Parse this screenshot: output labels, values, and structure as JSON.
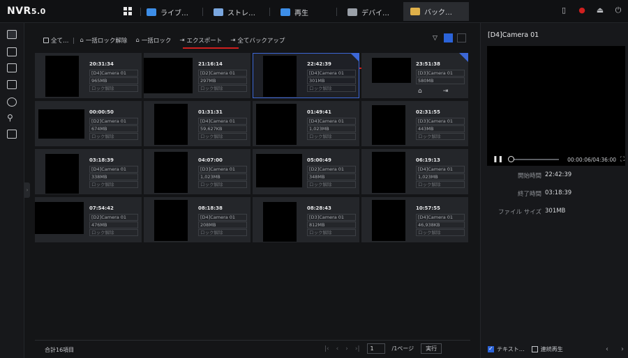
{
  "app": {
    "logo_main": "NVR",
    "logo_version": "5.0"
  },
  "tabs": [
    {
      "label": "ライブ…",
      "icon": "live-view-icon",
      "color": "#3d8ee8"
    },
    {
      "label": "ストレ…",
      "icon": "storage-icon",
      "color": "#7aa7e0"
    },
    {
      "label": "再生",
      "icon": "playback-icon",
      "color": "#3d8ee8"
    },
    {
      "label": "デバイ…",
      "icon": "device-icon",
      "color": "#9aa0a8"
    },
    {
      "label": "バック…",
      "icon": "backup-folder-icon",
      "color": "#e0b14a"
    }
  ],
  "top_right_icons": [
    "battery-icon",
    "alarm-bell-icon",
    "export-icon",
    "power-icon"
  ],
  "toolbar": {
    "select_all": "全て…",
    "unlock_all": "一括ロック解除",
    "lock_all": "一括ロック",
    "export": "エクスポート",
    "backup_all": "全てバックアップ"
  },
  "cards": [
    {
      "time": "20:31:34",
      "camera": "[D4]Camera 01",
      "size": "965MB",
      "lock": "ロック解除",
      "selected": false
    },
    {
      "time": "21:16:14",
      "camera": "[D2]Camera 01",
      "size": "297MB",
      "lock": "ロック解除",
      "selected": false
    },
    {
      "time": "22:42:39",
      "camera": "[D4]Camera 01",
      "size": "301MB",
      "lock": "ロック解除",
      "selected": true
    },
    {
      "time": "23:51:38",
      "camera": "[D3]Camera 01",
      "size": "580MB",
      "lock": "",
      "selected": false
    },
    {
      "time": "00:00:50",
      "camera": "[D2]Camera 01",
      "size": "674MB",
      "lock": "ロック解除",
      "selected": false
    },
    {
      "time": "01:31:31",
      "camera": "[D4]Camera 01",
      "size": "59,627KB",
      "lock": "ロック解除",
      "selected": false
    },
    {
      "time": "01:49:41",
      "camera": "[D4]Camera 01",
      "size": "1,023MB",
      "lock": "ロック解除",
      "selected": false
    },
    {
      "time": "02:31:55",
      "camera": "[D3]Camera 01",
      "size": "443MB",
      "lock": "ロック解除",
      "selected": false
    },
    {
      "time": "03:18:39",
      "camera": "[D4]Camera 01",
      "size": "338MB",
      "lock": "ロック解除",
      "selected": false
    },
    {
      "time": "04:07:00",
      "camera": "[D3]Camera 01",
      "size": "1,023MB",
      "lock": "ロック解除",
      "selected": false
    },
    {
      "time": "05:00:49",
      "camera": "[D2]Camera 01",
      "size": "348MB",
      "lock": "ロック解除",
      "selected": false
    },
    {
      "time": "06:19:13",
      "camera": "[D4]Camera 01",
      "size": "1,023MB",
      "lock": "ロック解除",
      "selected": false
    },
    {
      "time": "07:54:42",
      "camera": "[D2]Camera 01",
      "size": "476MB",
      "lock": "ロック解除",
      "selected": false
    },
    {
      "time": "08:18:38",
      "camera": "[D4]Camera 01",
      "size": "208MB",
      "lock": "ロック解除",
      "selected": false
    },
    {
      "time": "08:28:43",
      "camera": "[D3]Camera 01",
      "size": "812MB",
      "lock": "ロック解除",
      "selected": false
    },
    {
      "time": "10:57:55",
      "camera": "[D4]Camera 01",
      "size": "46,938KB",
      "lock": "ロック解除",
      "selected": false
    }
  ],
  "footer": {
    "total": "合計16項目",
    "page_value": "1",
    "page_of": "/1ページ",
    "go": "実行"
  },
  "preview": {
    "camera_title": "[D4]Camera 01",
    "time_readout": "00:00:06/04:36:00",
    "start_label": "開始時間",
    "start_value": "22:42:39",
    "end_label": "終了時間",
    "end_value": "03:18:39",
    "size_label": "ファイル サイズ",
    "size_value": "301MB",
    "text_label": "テキスト…",
    "continuous_label": "連続再生"
  },
  "colors": {
    "accent_blue": "#2b63d9",
    "selection_border": "#3c67d6",
    "annotation_red": "#d0201f"
  }
}
